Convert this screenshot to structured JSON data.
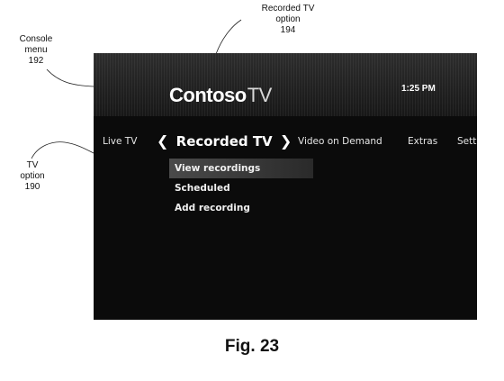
{
  "callouts": {
    "console_menu": {
      "line1": "Console",
      "line2": "menu",
      "ref": "192"
    },
    "recorded_tv": {
      "line1": "Recorded TV",
      "line2": "option",
      "ref": "194"
    },
    "tv_option": {
      "line1": "TV",
      "line2": "option",
      "ref": "190"
    }
  },
  "screen": {
    "brand": "Contoso",
    "brand_suffix": "TV",
    "clock": "1:25 PM",
    "menu": {
      "items": [
        "Live TV",
        "Recorded TV",
        "Video on Demand",
        "Extras",
        "Setti"
      ],
      "active_index": 1,
      "prev_glyph": "❮",
      "next_glyph": "❯"
    },
    "submenu": {
      "items": [
        "View recordings",
        "Scheduled",
        "Add recording"
      ],
      "selected_index": 0
    }
  },
  "figure_label": "Fig. 23"
}
